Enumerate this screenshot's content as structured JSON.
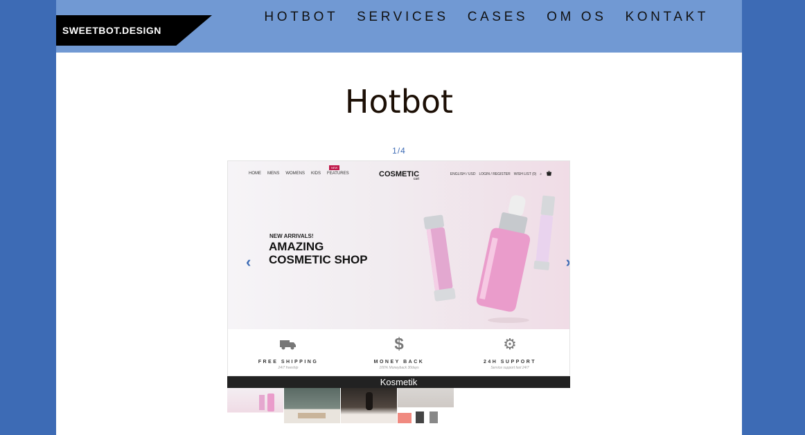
{
  "header": {
    "logo_text": "SWEETBOT.DESIGN",
    "nav": [
      "HOTBOT",
      "SERVICES",
      "CASES",
      "OM OS",
      "KONTAKT"
    ]
  },
  "page": {
    "title": "Hotbot"
  },
  "slider": {
    "counter": "1/4",
    "caption": "Kosmetik",
    "prev_icon": "chevron-left-icon",
    "next_icon": "chevron-right-icon",
    "slide": {
      "nav": [
        "HOME",
        "MENS",
        "WOMENS",
        "KIDS",
        "FEATURES"
      ],
      "new_badge": "NEW",
      "brand": "COSMETIC",
      "brand_sub": "cart",
      "right_links": [
        "ENGLISH / USD",
        "LOGIN / REGISTER",
        "WISH LIST (0)"
      ],
      "eyebrow": "NEW ARRIVALS!",
      "headline_line1": "AMAZING",
      "headline_line2": "COSMETIC SHOP",
      "features": [
        {
          "title": "FREE SHIPPING",
          "sub": "24/7 freeship",
          "icon": "truck-icon"
        },
        {
          "title": "MONEY BACK",
          "sub": "100% Moneyback 30days",
          "icon": "dollar-icon"
        },
        {
          "title": "24H SUPPORT",
          "sub": "Service support fast 24/7",
          "icon": "gear-icon"
        }
      ]
    },
    "thumbnails_count": 4
  },
  "colors": {
    "background": "#3d6bb5",
    "header": "#7199d3",
    "accent": "#3d6bb5"
  }
}
